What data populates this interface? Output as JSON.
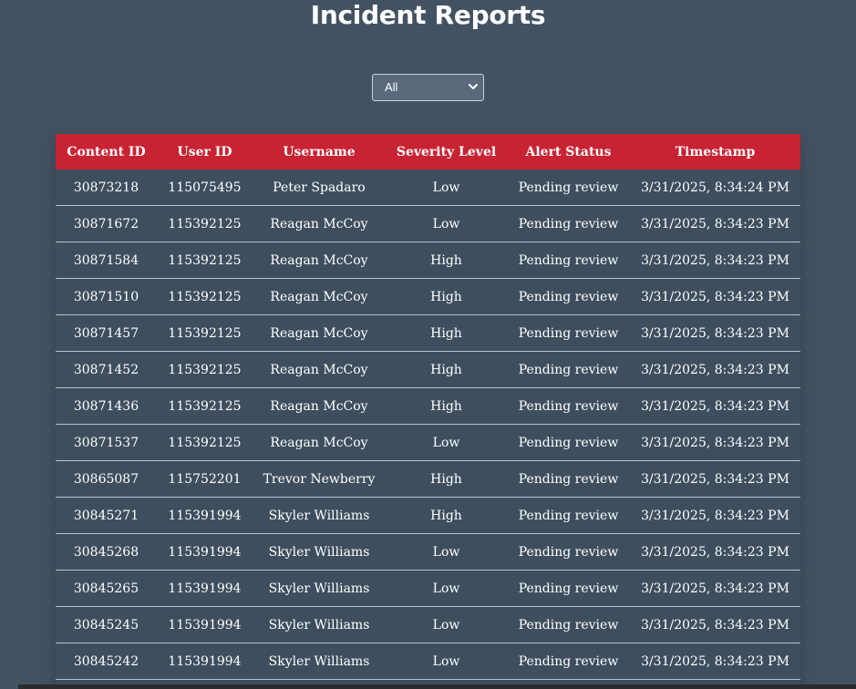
{
  "page": {
    "title": "Incident Reports"
  },
  "filter": {
    "selected": "All",
    "icon": "chevron-down-icon"
  },
  "table": {
    "columns": [
      "Content ID",
      "User ID",
      "Username",
      "Severity Level",
      "Alert Status",
      "Timestamp"
    ],
    "rows": [
      [
        "30873218",
        "115075495",
        "Peter Spadaro",
        "Low",
        "Pending review",
        "3/31/2025, 8:34:24 PM"
      ],
      [
        "30871672",
        "115392125",
        "Reagan McCoy",
        "Low",
        "Pending review",
        "3/31/2025, 8:34:23 PM"
      ],
      [
        "30871584",
        "115392125",
        "Reagan McCoy",
        "High",
        "Pending review",
        "3/31/2025, 8:34:23 PM"
      ],
      [
        "30871510",
        "115392125",
        "Reagan McCoy",
        "High",
        "Pending review",
        "3/31/2025, 8:34:23 PM"
      ],
      [
        "30871457",
        "115392125",
        "Reagan McCoy",
        "High",
        "Pending review",
        "3/31/2025, 8:34:23 PM"
      ],
      [
        "30871452",
        "115392125",
        "Reagan McCoy",
        "High",
        "Pending review",
        "3/31/2025, 8:34:23 PM"
      ],
      [
        "30871436",
        "115392125",
        "Reagan McCoy",
        "High",
        "Pending review",
        "3/31/2025, 8:34:23 PM"
      ],
      [
        "30871537",
        "115392125",
        "Reagan McCoy",
        "Low",
        "Pending review",
        "3/31/2025, 8:34:23 PM"
      ],
      [
        "30865087",
        "115752201",
        "Trevor Newberry",
        "High",
        "Pending review",
        "3/31/2025, 8:34:23 PM"
      ],
      [
        "30845271",
        "115391994",
        "Skyler Williams",
        "High",
        "Pending review",
        "3/31/2025, 8:34:23 PM"
      ],
      [
        "30845268",
        "115391994",
        "Skyler Williams",
        "Low",
        "Pending review",
        "3/31/2025, 8:34:23 PM"
      ],
      [
        "30845265",
        "115391994",
        "Skyler Williams",
        "Low",
        "Pending review",
        "3/31/2025, 8:34:23 PM"
      ],
      [
        "30845245",
        "115391994",
        "Skyler Williams",
        "Low",
        "Pending review",
        "3/31/2025, 8:34:23 PM"
      ],
      [
        "30845242",
        "115391994",
        "Skyler Williams",
        "Low",
        "Pending review",
        "3/31/2025, 8:34:23 PM"
      ]
    ]
  },
  "colors": {
    "background": "#435263",
    "header": "#c82333",
    "row_divider": "#b8c2cc"
  }
}
